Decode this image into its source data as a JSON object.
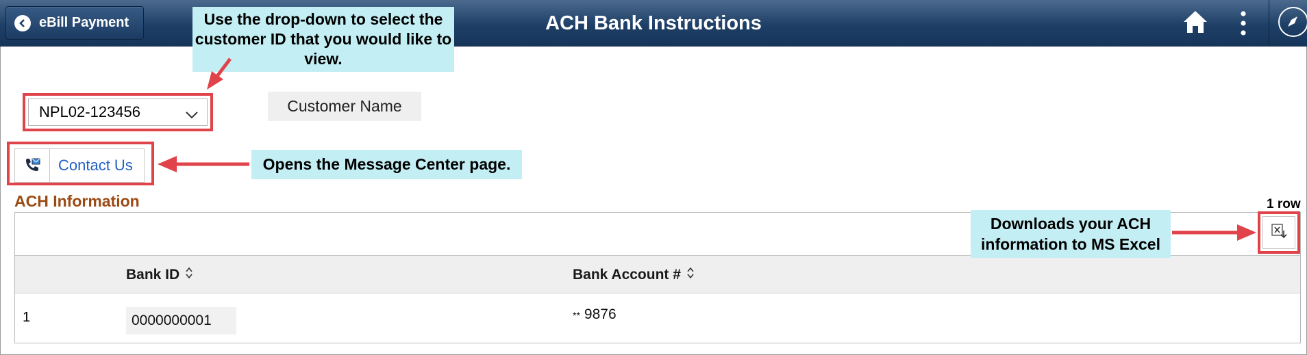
{
  "header": {
    "back_label": "eBill Payment",
    "title": "ACH Bank Instructions",
    "home_icon": "home-icon",
    "actions_icon": "kebab-menu-icon",
    "nav_icon": "navbar-compass-icon",
    "colors": {
      "bar_top": "#4b6a8e",
      "bar_bottom": "#17355a"
    }
  },
  "customer": {
    "id_prefix": "NPL02-",
    "id_value": "123456",
    "name_label": "Customer Name"
  },
  "contact": {
    "label": "Contact Us",
    "icon": "phone-mail-icon"
  },
  "ach": {
    "section_title": "ACH Information",
    "row_count": "1 row",
    "columns": [
      "Bank ID",
      "Bank Account #"
    ],
    "rows": [
      {
        "num": "1",
        "bank_id": "0000000001",
        "mask": "**",
        "account": "9876"
      }
    ],
    "excel_icon": "excel-download-icon"
  },
  "callouts": {
    "dropdown": "Use the drop-down to select the customer ID that you would like to view.",
    "contact": "Opens the Message Center page.",
    "excel": "Downloads your ACH information to MS Excel"
  },
  "colors": {
    "callout_bg": "#c3eef3",
    "highlight_border": "#e0434a",
    "section_title": "#9b4a12",
    "link": "#2260c4"
  }
}
